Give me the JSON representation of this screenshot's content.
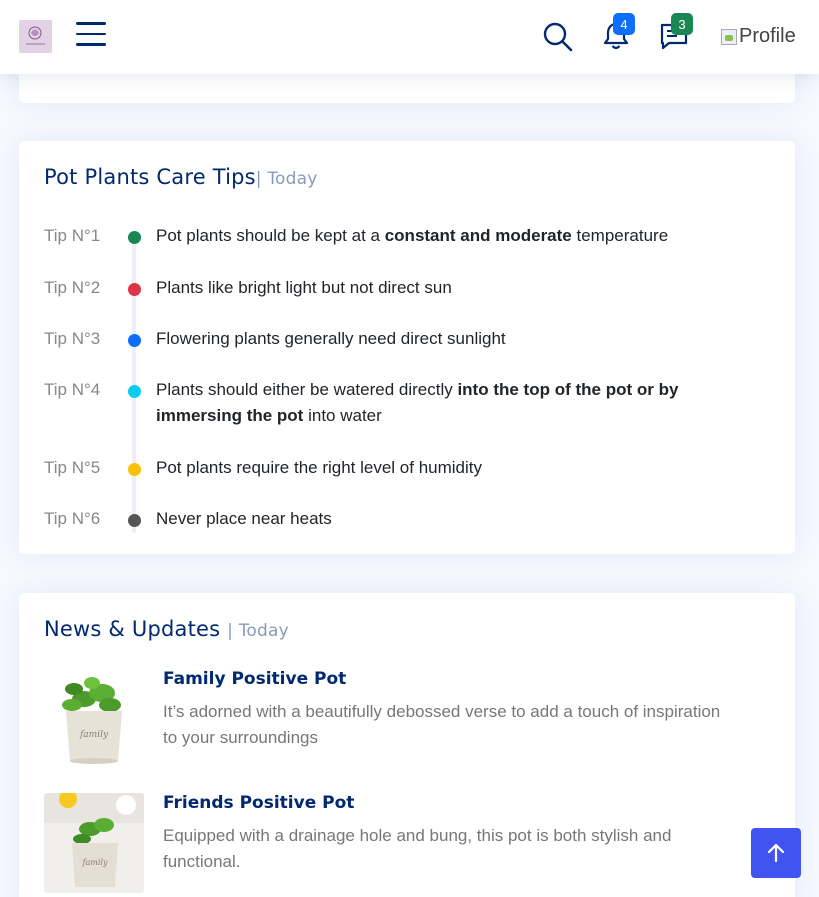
{
  "header": {
    "logo_alt": "logo",
    "notifications_count": "4",
    "messages_count": "3",
    "profile_label": "Profile"
  },
  "tips": {
    "title": "Pot Plants Care Tips",
    "subtitle": "| Today",
    "items": [
      {
        "label": "Tip N°1",
        "color": "#198754",
        "pre": "Pot plants should be kept at a ",
        "bold": "constant and moderate",
        "post": " temperature"
      },
      {
        "label": "Tip N°2",
        "color": "#dc3545",
        "pre": "Plants like bright light but not direct sun",
        "bold": "",
        "post": ""
      },
      {
        "label": "Tip N°3",
        "color": "#0d6efd",
        "pre": "Flowering plants generally need direct sunlight",
        "bold": "",
        "post": ""
      },
      {
        "label": "Tip N°4",
        "color": "#0dcaf0",
        "pre": "Plants should either be watered directly ",
        "bold": "into the top of the pot or by immersing the pot",
        "post": " into water"
      },
      {
        "label": "Tip N°5",
        "color": "#ffc107",
        "pre": "Pot plants require the right level of humidity",
        "bold": "",
        "post": ""
      },
      {
        "label": "Tip N°6",
        "color": "#555555",
        "pre": "Never place near heats",
        "bold": "",
        "post": ""
      }
    ]
  },
  "news": {
    "title": "News & Updates",
    "subtitle": "| Today",
    "items": [
      {
        "title": "Family Positive Pot",
        "desc": "It’s adorned with a beautifully debossed verse to add a touch of inspiration to your surroundings"
      },
      {
        "title": "Friends Positive Pot",
        "desc": "Equipped with a drainage hole and bung, this pot is both stylish and functional."
      }
    ]
  }
}
